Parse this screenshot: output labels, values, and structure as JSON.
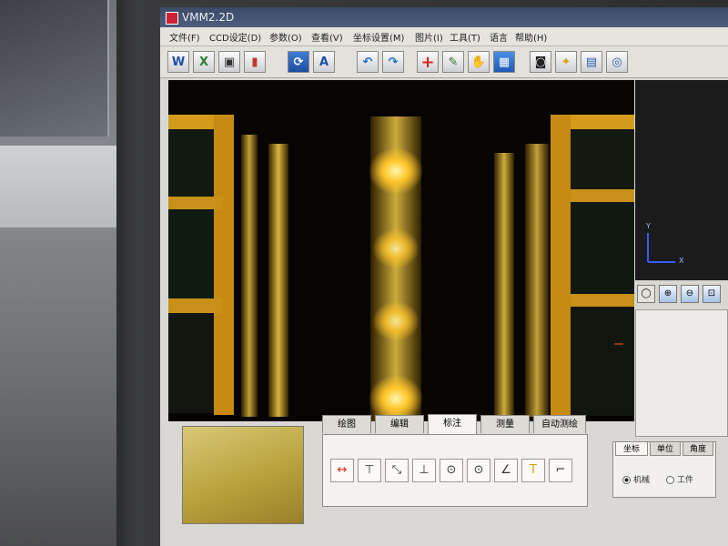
{
  "window": {
    "title": "VMM2.2D"
  },
  "menu": [
    "文件(F)",
    "CCD设定(D)",
    "参数(O)",
    "查看(V)",
    "坐标设置(M)",
    "图片(I)",
    "工具(T)",
    "语言",
    "帮助(H)"
  ],
  "toolbar": {
    "buttons": [
      {
        "name": "word-export-button",
        "icon": "word-icon",
        "glyph": "W"
      },
      {
        "name": "excel-export-button",
        "icon": "excel-icon",
        "glyph": "X"
      },
      {
        "name": "save-button",
        "icon": "save-icon",
        "glyph": "▣"
      },
      {
        "name": "chart-button",
        "icon": "bar-chart-icon",
        "glyph": "▮"
      },
      {
        "name": "camera-settings-button",
        "icon": "camera-settings-icon",
        "glyph": "⟳"
      },
      {
        "name": "text-button",
        "icon": "text-icon",
        "glyph": "A"
      },
      {
        "name": "undo-button",
        "icon": "undo-icon",
        "glyph": "↶"
      },
      {
        "name": "redo-button",
        "icon": "redo-icon",
        "glyph": "↷"
      },
      {
        "name": "crosshair-button",
        "icon": "crosshair-icon",
        "glyph": "+"
      },
      {
        "name": "wand-button",
        "icon": "wand-icon",
        "glyph": "✎"
      },
      {
        "name": "pan-button",
        "icon": "hand-icon",
        "glyph": "✋"
      },
      {
        "name": "grid-button",
        "icon": "grid-icon",
        "glyph": "▦"
      },
      {
        "name": "snapshot-button",
        "icon": "camera-icon",
        "glyph": "◙"
      },
      {
        "name": "light-button",
        "icon": "bulb-icon",
        "glyph": "✦"
      },
      {
        "name": "image-settings-button",
        "icon": "image-settings-icon",
        "glyph": "▤"
      },
      {
        "name": "target-button",
        "icon": "target-icon",
        "glyph": "◎"
      }
    ]
  },
  "axis": {
    "y": "Y",
    "x": "X"
  },
  "tabs": [
    "绘图",
    "编辑",
    "标注",
    "测量",
    "自动测绘"
  ],
  "active_tab": "标注",
  "measure_tools": [
    {
      "name": "horizontal-dimension-tool",
      "glyph": "↔"
    },
    {
      "name": "vertical-dimension-tool",
      "glyph": "⊤"
    },
    {
      "name": "diagonal-dimension-tool",
      "glyph": "⤡"
    },
    {
      "name": "perpendicular-tool",
      "glyph": "⊥"
    },
    {
      "name": "circle-center-tool",
      "glyph": "⊙"
    },
    {
      "name": "circle-diameter-tool",
      "glyph": "⊙"
    },
    {
      "name": "angle-tool",
      "glyph": "∠"
    },
    {
      "name": "text-annotation-tool",
      "glyph": "T"
    },
    {
      "name": "leader-line-tool",
      "glyph": "⌐"
    }
  ],
  "coord_panel": {
    "tabs": [
      "坐标",
      "单位",
      "角度"
    ],
    "options": [
      "机械",
      "工件"
    ],
    "selected": "机械"
  }
}
